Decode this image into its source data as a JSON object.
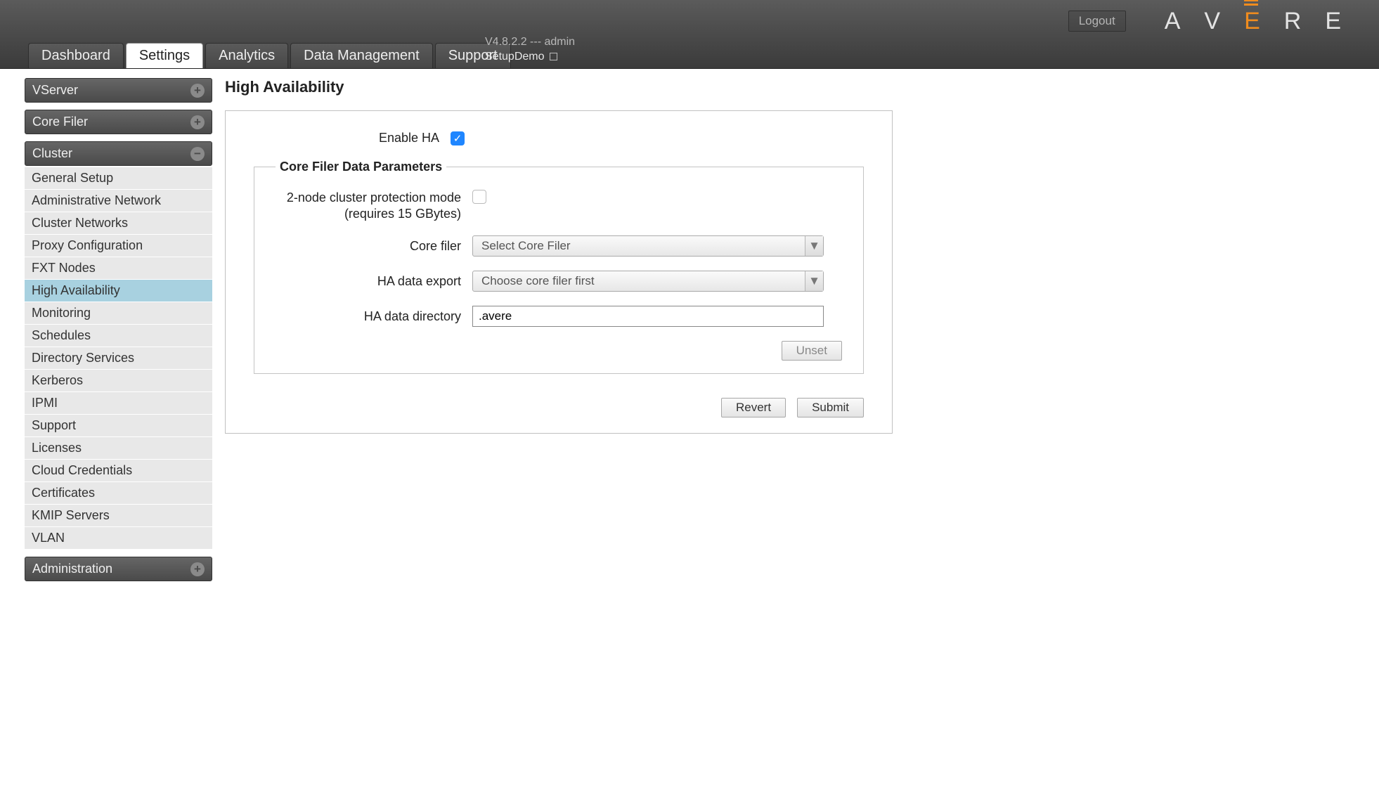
{
  "header": {
    "logout": "Logout",
    "version_line": "V4.8.2.2 --- admin",
    "cluster_name": "SetupDemo",
    "logo_letters": {
      "a": "A",
      "v": "V",
      "e": "E",
      "r": "R",
      "e2": "E"
    },
    "tabs": [
      {
        "id": "dashboard",
        "label": "Dashboard"
      },
      {
        "id": "settings",
        "label": "Settings"
      },
      {
        "id": "analytics",
        "label": "Analytics"
      },
      {
        "id": "data-management",
        "label": "Data Management"
      },
      {
        "id": "support",
        "label": "Support"
      }
    ],
    "active_tab": "settings"
  },
  "sidebar": {
    "sections": [
      {
        "id": "vserver",
        "label": "VServer",
        "expanded": false,
        "items": []
      },
      {
        "id": "core-filer",
        "label": "Core Filer",
        "expanded": false,
        "items": []
      },
      {
        "id": "cluster",
        "label": "Cluster",
        "expanded": true,
        "items": [
          {
            "id": "general-setup",
            "label": "General Setup"
          },
          {
            "id": "administrative-network",
            "label": "Administrative Network"
          },
          {
            "id": "cluster-networks",
            "label": "Cluster Networks"
          },
          {
            "id": "proxy-configuration",
            "label": "Proxy Configuration"
          },
          {
            "id": "fxt-nodes",
            "label": "FXT Nodes"
          },
          {
            "id": "high-availability",
            "label": "High Availability"
          },
          {
            "id": "monitoring",
            "label": "Monitoring"
          },
          {
            "id": "schedules",
            "label": "Schedules"
          },
          {
            "id": "directory-services",
            "label": "Directory Services"
          },
          {
            "id": "kerberos",
            "label": "Kerberos"
          },
          {
            "id": "ipmi",
            "label": "IPMI"
          },
          {
            "id": "support",
            "label": "Support"
          },
          {
            "id": "licenses",
            "label": "Licenses"
          },
          {
            "id": "cloud-credentials",
            "label": "Cloud Credentials"
          },
          {
            "id": "certificates",
            "label": "Certificates"
          },
          {
            "id": "kmip-servers",
            "label": "KMIP Servers"
          },
          {
            "id": "vlan",
            "label": "VLAN"
          }
        ]
      },
      {
        "id": "administration",
        "label": "Administration",
        "expanded": false,
        "items": []
      }
    ],
    "active_item": "high-availability"
  },
  "page": {
    "title": "High Availability",
    "enable_ha_label": "Enable HA",
    "enable_ha_checked": true,
    "group_legend": "Core Filer Data Parameters",
    "two_node_label": "2-node cluster protection mode (requires 15 GBytes)",
    "two_node_checked": false,
    "core_filer_label": "Core filer",
    "core_filer_value": "Select Core Filer",
    "ha_export_label": "HA data export",
    "ha_export_value": "Choose core filer first",
    "ha_dir_label": "HA data directory",
    "ha_dir_value": ".avere",
    "unset_btn": "Unset",
    "revert_btn": "Revert",
    "submit_btn": "Submit"
  }
}
